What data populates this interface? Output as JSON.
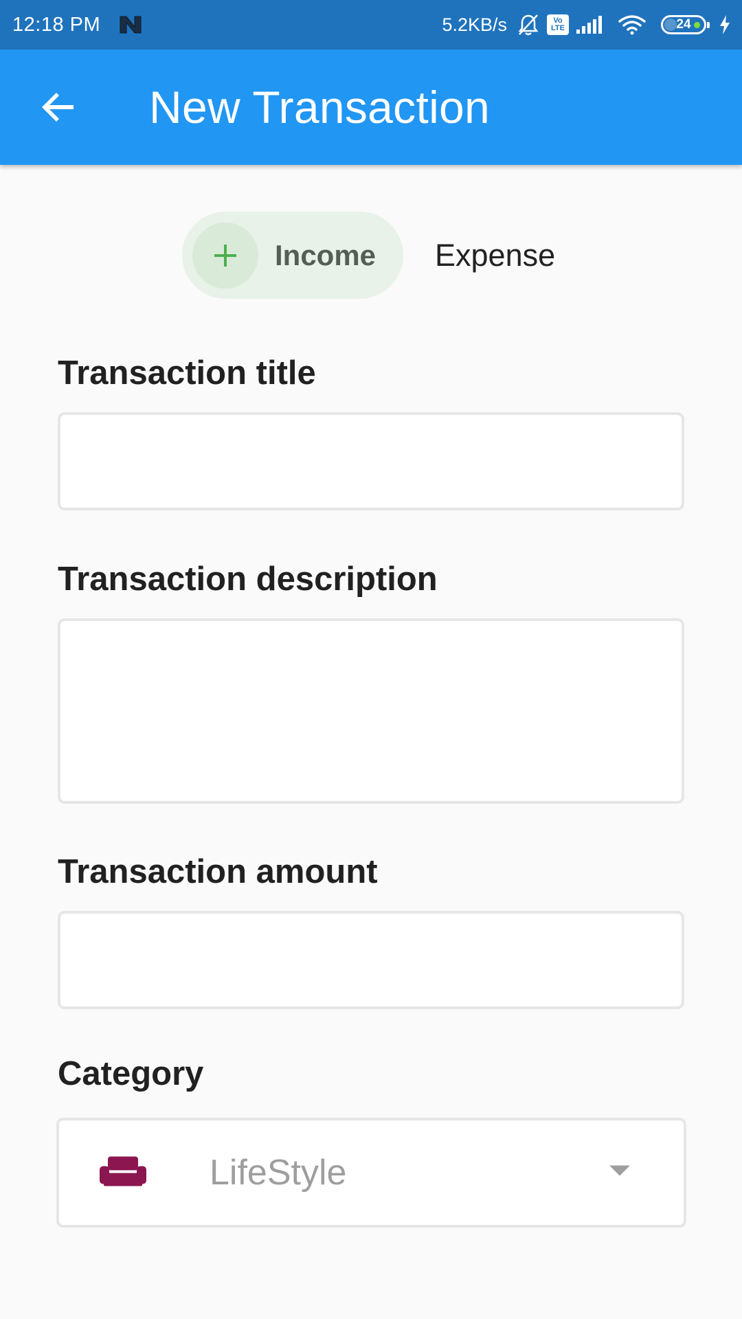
{
  "status_bar": {
    "time": "12:18 PM",
    "network_speed": "5.2KB/s",
    "battery_level": "24",
    "volte_line1": "Vo",
    "volte_line2": "LTE",
    "icons": [
      "n-app-icon",
      "bell-off-icon",
      "volte-icon",
      "signal-icon",
      "wifi-icon",
      "battery-icon",
      "charging-icon"
    ]
  },
  "app_bar": {
    "title": "New Transaction",
    "back_icon": "arrow-back-icon",
    "color": "#2196f3"
  },
  "type_toggle": {
    "options": [
      "Income",
      "Expense"
    ],
    "selected": "Income",
    "income_label": "Income",
    "expense_label": "Expense",
    "income_icon": "plus-icon",
    "accent": "#4caf50"
  },
  "form": {
    "title_label": "Transaction title",
    "title_value": "",
    "description_label": "Transaction description",
    "description_value": "",
    "amount_label": "Transaction amount",
    "amount_value": "",
    "category_label": "Category",
    "category_value": "LifeStyle",
    "category_icon": "sofa-icon",
    "category_icon_color": "#8b1650"
  }
}
